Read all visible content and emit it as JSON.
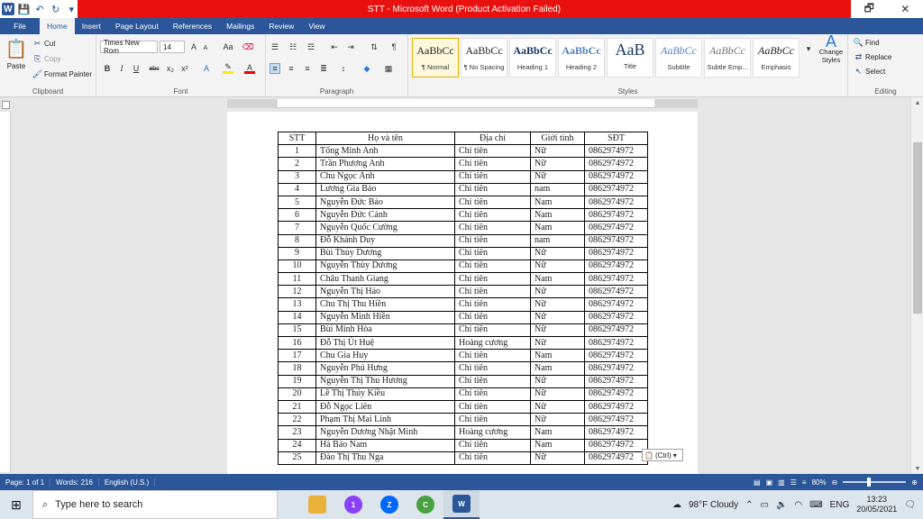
{
  "title_bar": {
    "title": "STT - Microsoft Word (Product Activation Failed)",
    "window_controls": {
      "restore": "🗗",
      "close": "✕"
    }
  },
  "ribbon_tabs": [
    "File",
    "Home",
    "Insert",
    "Page Layout",
    "References",
    "Mailings",
    "Review",
    "View"
  ],
  "clipboard": {
    "paste": "Paste",
    "cut": "Cut",
    "copy": "Copy",
    "format_painter": "Format Painter",
    "label": "Clipboard"
  },
  "font": {
    "name": "Times New Rom",
    "size": "14",
    "label": "Font"
  },
  "paragraph": {
    "label": "Paragraph"
  },
  "styles": {
    "label": "Styles",
    "items": [
      {
        "sample": "AaBbCc",
        "name": "¶ Normal"
      },
      {
        "sample": "AaBbCc",
        "name": "¶ No Spacing"
      },
      {
        "sample": "AaBbCc",
        "name": "Heading 1"
      },
      {
        "sample": "AaBbCc",
        "name": "Heading 2"
      },
      {
        "sample": "AaB",
        "name": "Title"
      },
      {
        "sample": "AaBbCc",
        "name": "Subtitle"
      },
      {
        "sample": "AaBbCc",
        "name": "Subtle Emp..."
      },
      {
        "sample": "AaBbCc",
        "name": "Emphasis"
      }
    ],
    "change_styles": "Change Styles"
  },
  "editing": {
    "find": "Find",
    "replace": "Replace",
    "select": "Select",
    "label": "Editing"
  },
  "table": {
    "headers": [
      "STT",
      "Họ và tên",
      "Địa chỉ",
      "Giới tính",
      "SĐT"
    ],
    "rows": [
      [
        "1",
        "Tống Minh Anh",
        "Chí tiên",
        "Nữ",
        "0862974972"
      ],
      [
        "2",
        "Trần Phương Anh",
        "Chí tiên",
        "Nữ",
        "0862974972"
      ],
      [
        "3",
        "Chu Ngọc Ánh",
        "Chí tiên",
        "Nữ",
        "0862974972"
      ],
      [
        "4",
        "Lương Gia Bảo",
        "Chí tiên",
        "nam",
        "0862974972"
      ],
      [
        "5",
        "Nguyễn Đức Bảo",
        "Chí tiên",
        "Nam",
        "0862974972"
      ],
      [
        "6",
        "Nguyễn Đức Cảnh",
        "Chí tiên",
        "Nam",
        "0862974972"
      ],
      [
        "7",
        "Nguyễn Quốc Cường",
        "Chí tiên",
        "Nam",
        "0862974972"
      ],
      [
        "8",
        "Đỗ Khánh Duy",
        "Chí tiên",
        "nam",
        "0862974972"
      ],
      [
        "9",
        "Bùi Thùy Dương",
        "Chí tiên",
        "Nữ",
        "0862974972"
      ],
      [
        "10",
        "Nguyễn Thùy Dương",
        "Chí tiên",
        "Nữ",
        "0862974972"
      ],
      [
        "11",
        "Châu Thanh Giang",
        "Chí tiên",
        "Nam",
        "0862974972"
      ],
      [
        "12",
        "Nguyễn Thị Hảo",
        "Chí tiên",
        "Nữ",
        "0862974972"
      ],
      [
        "13",
        "Chu Thị Thu Hiền",
        "Chí tiên",
        "Nữ",
        "0862974972"
      ],
      [
        "14",
        "Nguyễn Minh Hiền",
        "Chí tiên",
        "Nữ",
        "0862974972"
      ],
      [
        "15",
        "Bùi Minh Hòa",
        "Chí tiên",
        "Nữ",
        "0862974972"
      ],
      [
        "16",
        "Đỗ Thị Út Huệ",
        "Hoàng cương",
        "Nữ",
        "0862974972"
      ],
      [
        "17",
        "Chu Gia Huy",
        "Chí tiên",
        "Nam",
        "0862974972"
      ],
      [
        "18",
        "Nguyễn Phú Hưng",
        "Chí tiên",
        "Nam",
        "0862974972"
      ],
      [
        "19",
        "Nguyễn Thị Thu Hương",
        "Chí tiên",
        "Nữ",
        "0862974972"
      ],
      [
        "20",
        "Lê Thị Thúy Kiều",
        "Chí tiên",
        "Nữ",
        "0862974972"
      ],
      [
        "21",
        "Đỗ Ngọc Liên",
        "Chí tiên",
        "Nữ",
        "0862974972"
      ],
      [
        "22",
        "Phạm Thị Mai Linh",
        "Chí tiên",
        "Nữ",
        "0862974972"
      ],
      [
        "23",
        "Nguyễn Dương Nhật Minh",
        "Hoàng cương",
        "Nam",
        "0862974972"
      ],
      [
        "24",
        "Hà Bảo Nam",
        "Chí tiên",
        "Nam",
        "0862974972"
      ],
      [
        "25",
        "Đào Thị Thu Nga",
        "Chí tiên",
        "Nữ",
        "0862974972"
      ]
    ]
  },
  "paste_options": "(Ctrl)",
  "status_bar": {
    "page": "Page: 1 of 1",
    "words": "Words: 216",
    "language": "English (U.S.)",
    "zoom": "80%",
    "zoom_level": 0.8
  },
  "taskbar": {
    "search_placeholder": "Type here to search",
    "weather": "98°F  Cloudy",
    "language": "ENG",
    "time": "13:23",
    "date": "20/05/2021",
    "apps": [
      {
        "name": "file-explorer",
        "color": "#e8b23a"
      },
      {
        "name": "messenger",
        "color": "#8a3ffc",
        "badge": "1"
      },
      {
        "name": "zalo",
        "color": "#0068ff"
      },
      {
        "name": "coc-coc",
        "color": "#48a23f"
      },
      {
        "name": "word",
        "color": "#2b579a"
      }
    ]
  },
  "colors": {
    "word_blue": "#2b579a",
    "title_red": "#e8110f"
  }
}
